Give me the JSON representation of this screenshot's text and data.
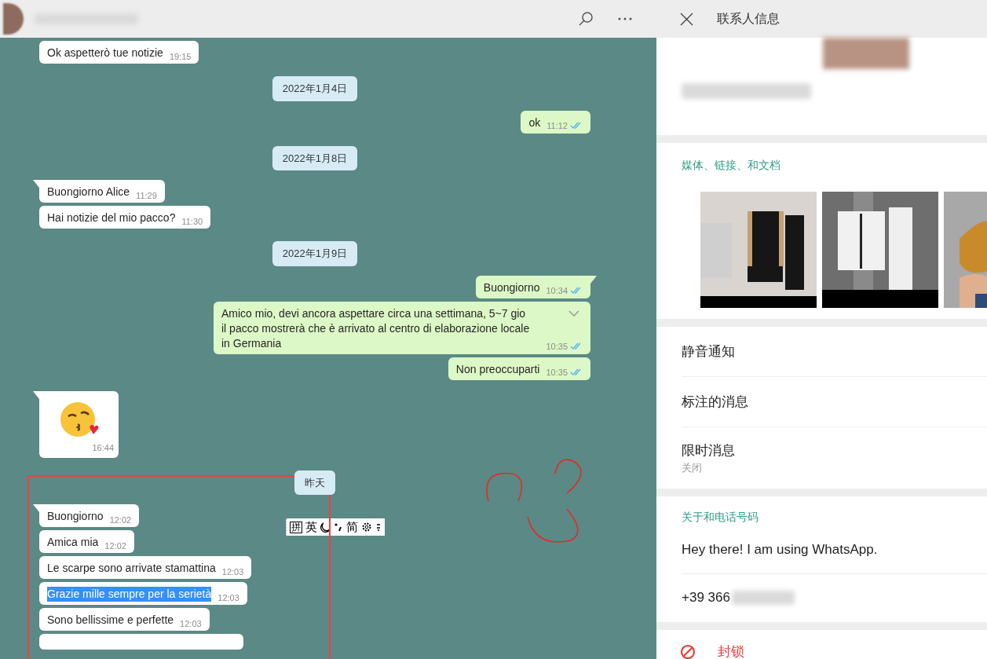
{
  "chat": {
    "messages": [
      {
        "kind": "in",
        "text": "Ok aspetterò tue notizie",
        "time": "19:15"
      },
      {
        "kind": "date",
        "text": "2022年1月4日"
      },
      {
        "kind": "out",
        "text": "ok",
        "time": "11:12",
        "read": true
      },
      {
        "kind": "date",
        "text": "2022年1月8日"
      },
      {
        "kind": "in",
        "text": "Buongiorno Alice",
        "time": "11:29",
        "tail": true
      },
      {
        "kind": "in",
        "text": "Hai notizie del mio pacco?",
        "time": "11:30"
      },
      {
        "kind": "date",
        "text": "2022年1月9日"
      },
      {
        "kind": "out",
        "text": "Buongiorno",
        "time": "10:34",
        "read": true,
        "tail": true
      },
      {
        "kind": "out",
        "text": "Amico mio, devi ancora aspettare circa una settimana, 5~7 gio",
        "text_2": "il pacco mostrerà che è arrivato al centro di elaborazione locale in Germania",
        "time": "10:35",
        "read": true,
        "menu": true
      },
      {
        "kind": "out",
        "text": "Non preoccuparti",
        "time": "10:35",
        "read": true
      },
      {
        "kind": "sticker",
        "time": "16:44",
        "tail": true
      },
      {
        "kind": "date",
        "text": "昨天"
      },
      {
        "kind": "in",
        "text": "Buongiorno",
        "time": "12:02",
        "tail": true
      },
      {
        "kind": "in",
        "text": "Amica mia",
        "time": "12:02"
      },
      {
        "kind": "in",
        "text": "Le scarpe sono arrivate stamattina",
        "time": "12:03"
      },
      {
        "kind": "in",
        "text": "Grazie mille sempre per la serietà",
        "time": "12:03",
        "text_selected": true
      },
      {
        "kind": "in",
        "text": "Sono bellissime e perfette",
        "time": "12:03"
      },
      {
        "kind": "in_cut"
      }
    ]
  },
  "ime_toolbar": {
    "items": [
      "拼",
      "英",
      "简"
    ]
  },
  "contact_panel": {
    "title": "联系人信息",
    "media": {
      "title": "媒体、链接、和文档"
    },
    "settings": [
      {
        "label": "静音通知"
      },
      {
        "label": "标注的消息"
      },
      {
        "label": "限时消息",
        "value": "关闭"
      }
    ],
    "about": {
      "title": "关于和电话号码",
      "status": "Hey there! I am using WhatsApp.",
      "phone": "+39 366"
    },
    "block": {
      "label": "封锁"
    }
  }
}
